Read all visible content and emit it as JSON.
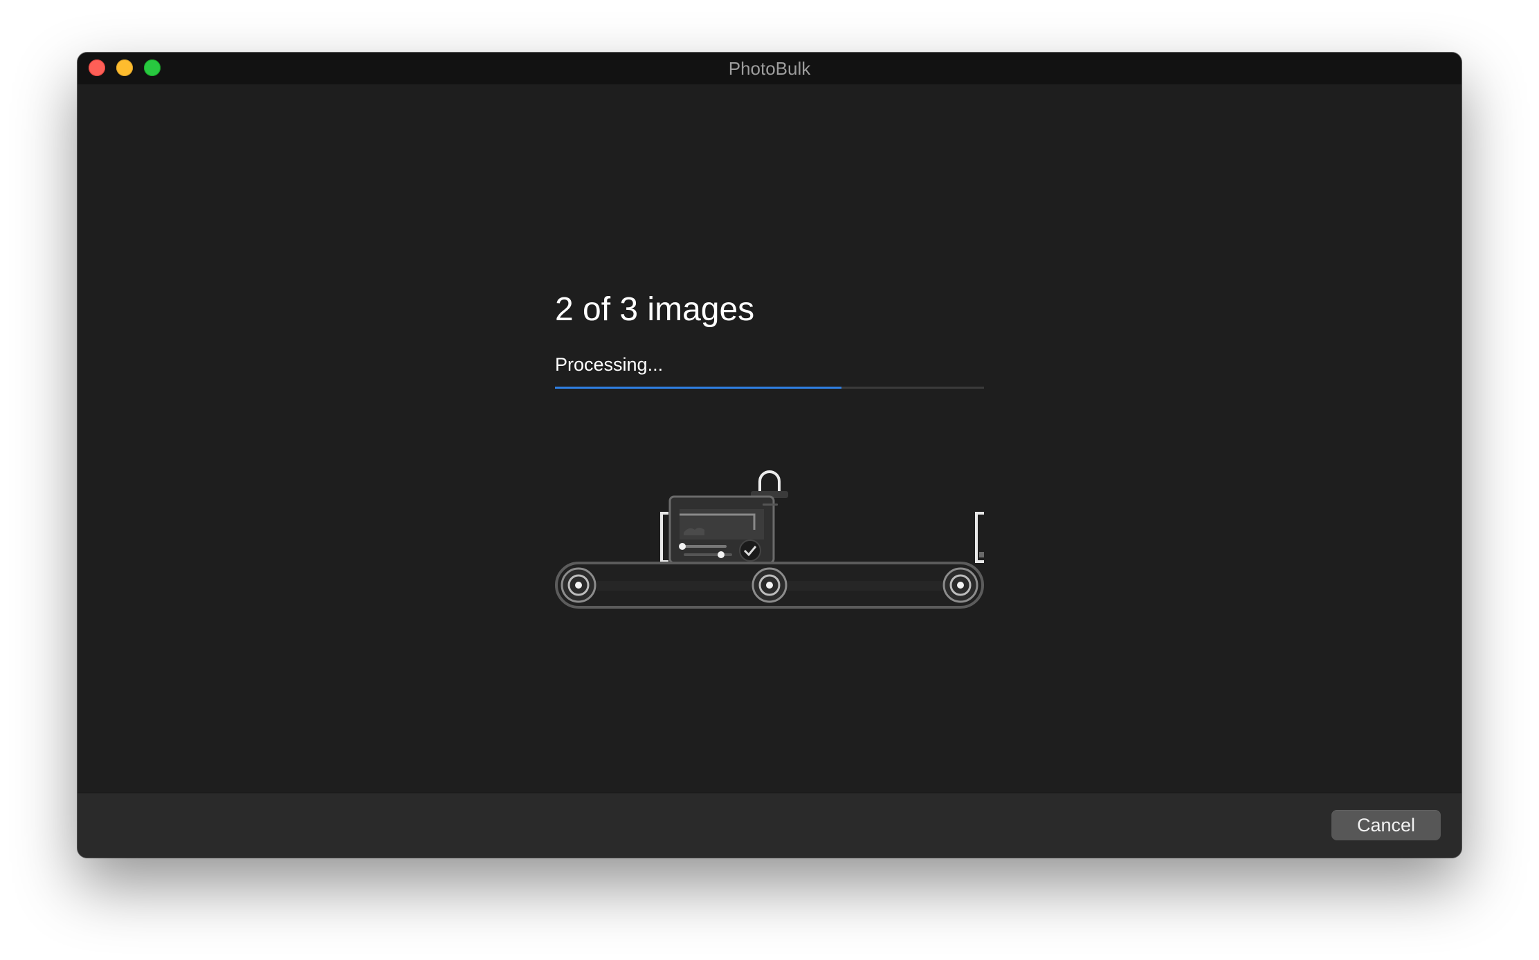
{
  "window": {
    "title": "PhotoBulk"
  },
  "progress": {
    "heading": "2 of 3 images",
    "status": "Processing...",
    "fraction": 0.667,
    "accent_color": "#2f7fe3"
  },
  "footer": {
    "cancel_label": "Cancel"
  },
  "icons": {
    "close": "close-window-icon",
    "minimize": "minimize-window-icon",
    "zoom": "zoom-window-icon",
    "illustration": "conveyor-processing-illustration"
  }
}
